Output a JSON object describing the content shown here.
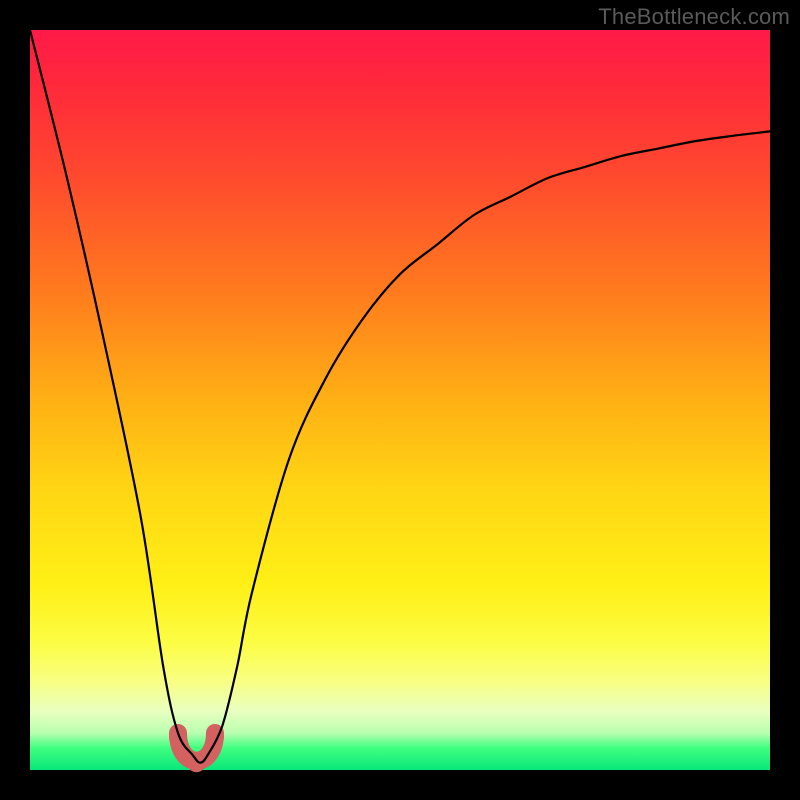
{
  "watermark": "TheBottleneck.com",
  "chart_data": {
    "type": "line",
    "title": "",
    "xlabel": "",
    "ylabel": "",
    "xlim": [
      0,
      100
    ],
    "ylim": [
      0,
      100
    ],
    "grid": false,
    "legend": false,
    "series": [
      {
        "name": "bottleneck-curve",
        "color": "#000000",
        "x": [
          0,
          5,
          10,
          15,
          18,
          20,
          22,
          23,
          24,
          26,
          28,
          30,
          35,
          40,
          45,
          50,
          55,
          60,
          65,
          70,
          75,
          80,
          85,
          90,
          95,
          100
        ],
        "y": [
          100,
          80,
          58,
          34,
          14,
          5,
          2,
          1,
          2,
          6,
          14,
          24,
          42,
          53,
          61,
          67,
          71,
          75,
          77.5,
          80,
          81.5,
          83,
          84,
          85,
          85.7,
          86.3
        ]
      }
    ],
    "annotations": [
      {
        "name": "valley-blob",
        "color": "#d2615f",
        "center_x": 22.5,
        "y_base": 0,
        "width": 5,
        "height": 5
      }
    ],
    "background_gradient": {
      "top": "#ff1a48",
      "mid_upper": "#ff9a1a",
      "mid": "#ffe414",
      "mid_lower": "#faff70",
      "bottom": "#08e67a"
    }
  }
}
